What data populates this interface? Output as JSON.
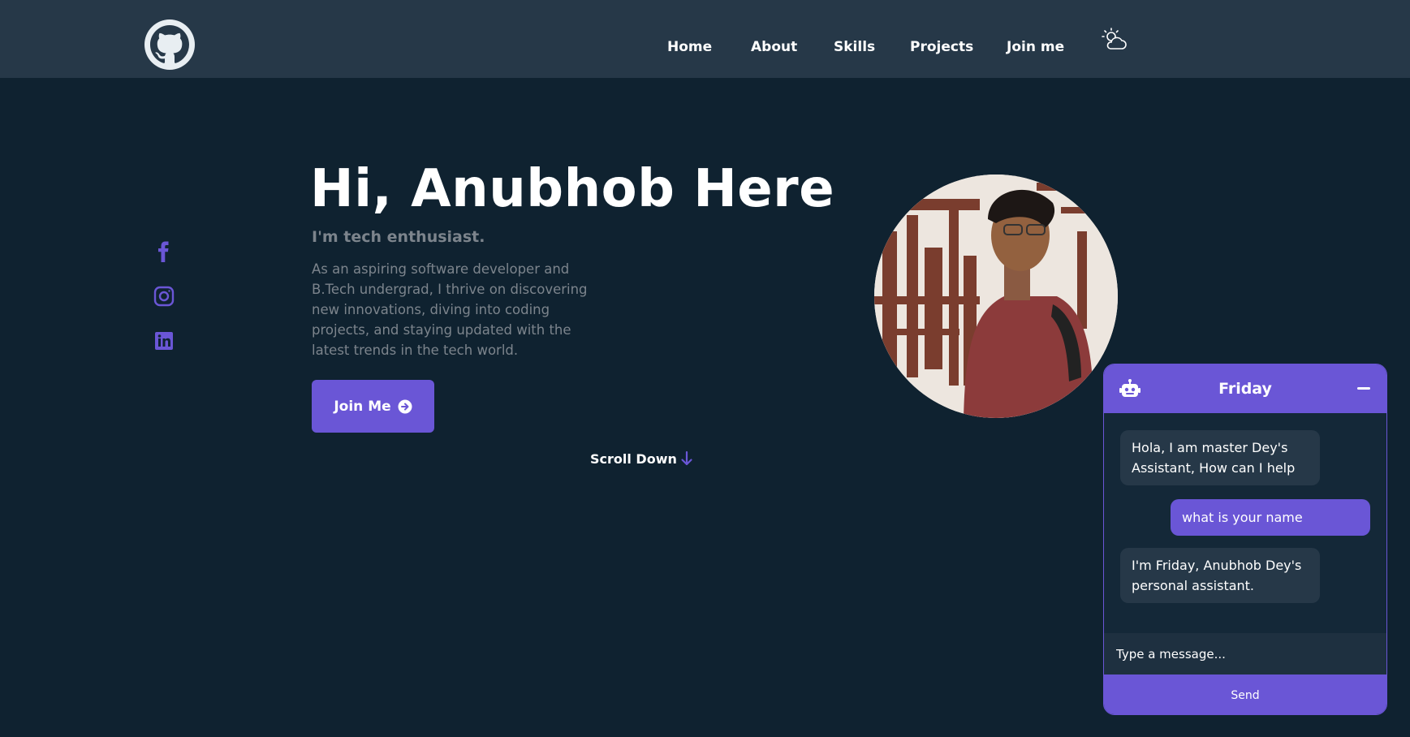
{
  "header": {
    "nav": [
      {
        "label": "Home"
      },
      {
        "label": "About"
      },
      {
        "label": "Skills"
      },
      {
        "label": "Projects"
      },
      {
        "label": "Join me"
      }
    ],
    "logo_icon": "github-icon",
    "theme_icon": "sun-cloud-icon"
  },
  "social": [
    {
      "icon": "facebook-icon"
    },
    {
      "icon": "instagram-icon"
    },
    {
      "icon": "linkedin-icon"
    }
  ],
  "hero": {
    "title": "Hi, Anubhob Here",
    "subtitle": "I'm tech enthusiast.",
    "description": "As an aspiring software developer and B.Tech undergrad, I thrive on discovering new innovations, diving into coding projects, and staying updated with the latest trends in the tech world.",
    "join_button": "Join Me",
    "scroll_label": "Scroll Down"
  },
  "chat": {
    "title": "Friday",
    "messages": [
      {
        "from": "bot",
        "text": "Hola, I am master Dey's Assistant, How can I help"
      },
      {
        "from": "user",
        "text": "what is your name"
      },
      {
        "from": "bot",
        "text": "I'm Friday, Anubhob Dey's personal assistant."
      }
    ],
    "input_placeholder": "Type a message...",
    "send_label": "Send"
  },
  "colors": {
    "background": "#0f2230",
    "header": "#263848",
    "accent": "#6a56d6",
    "muted_text": "#7c848c"
  }
}
